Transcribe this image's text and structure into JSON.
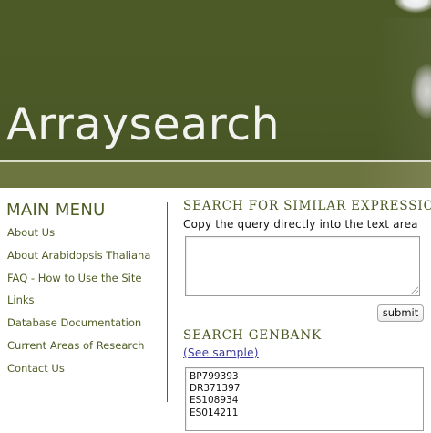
{
  "header": {
    "site_title": "Arraysearch"
  },
  "sidebar": {
    "title": "MAIN MENU",
    "items": [
      {
        "label": "About Us"
      },
      {
        "label": "About Arabidopsis Thaliana"
      },
      {
        "label": "FAQ - How to Use the Site"
      },
      {
        "label": "Links"
      },
      {
        "label": "Database Documentation"
      },
      {
        "label": "Current Areas of Research"
      },
      {
        "label": "Contact Us"
      }
    ]
  },
  "similar_search": {
    "heading": "SEARCH FOR SIMILAR EXPRESSIO",
    "instruction": "Copy the query directly into the text area",
    "query_value": "",
    "submit_label": "submit"
  },
  "genbank_search": {
    "heading": "SEARCH GENBANK",
    "sample_link": "(See sample)",
    "ids": [
      "BP799393",
      "DR371397",
      "ES108934",
      "ES014211"
    ]
  },
  "colors": {
    "banner": "#4b5927",
    "band": "#6c7440",
    "menu_text": "#4f5e26",
    "link": "#3b3aa0"
  }
}
